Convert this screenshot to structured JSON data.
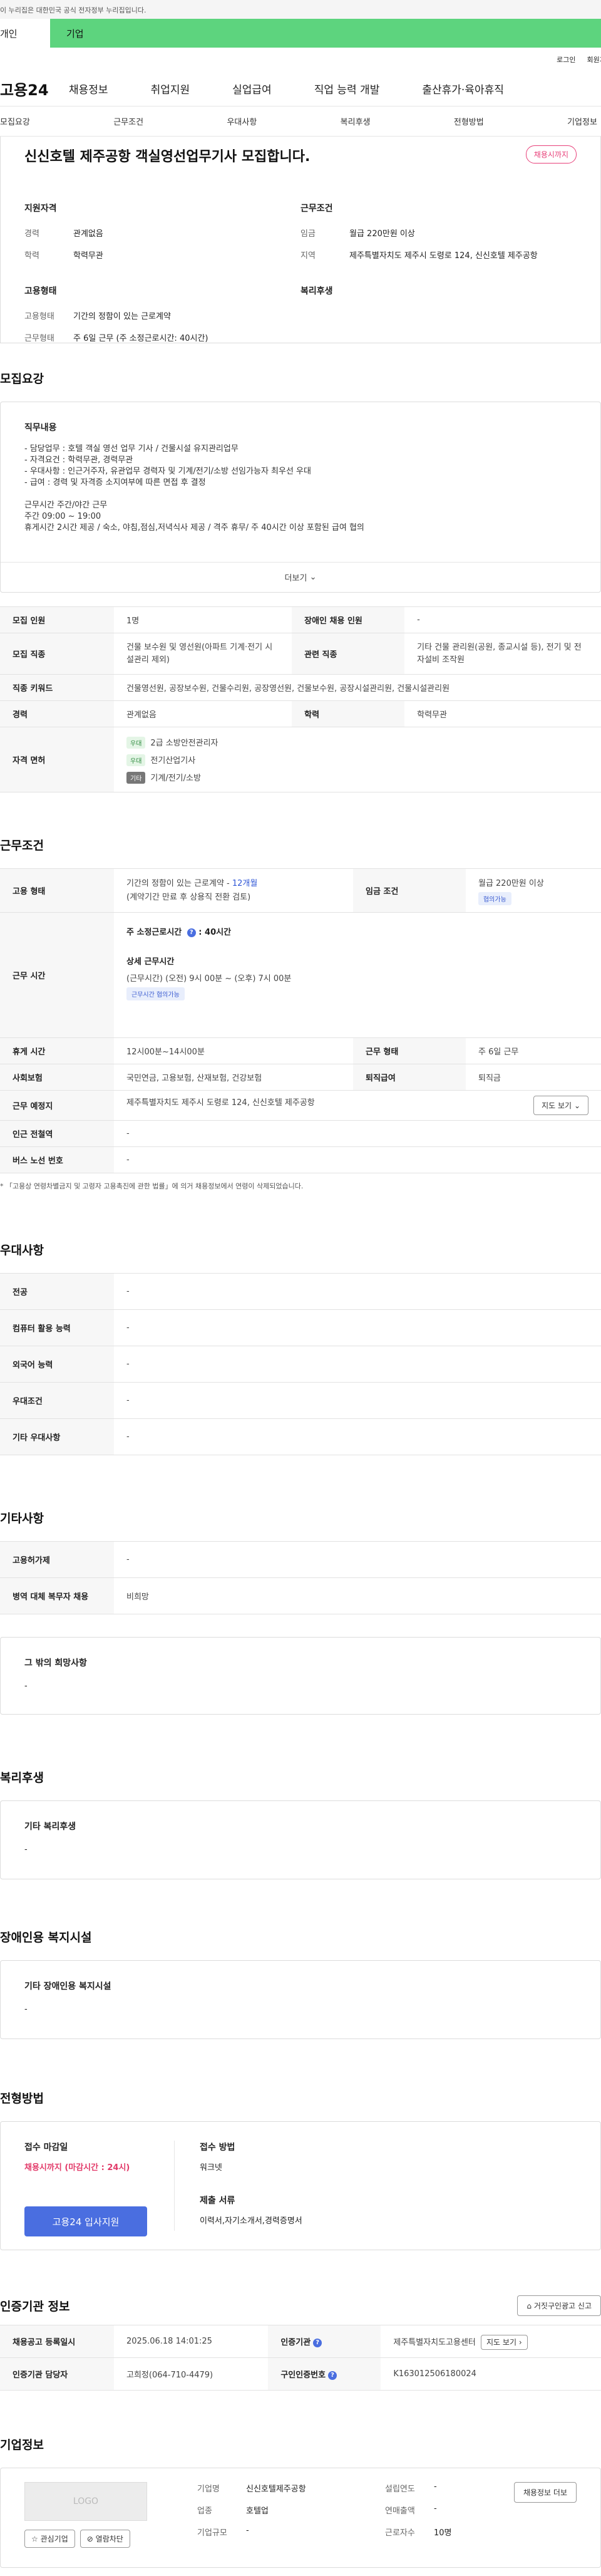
{
  "gov_banner": "이 누리집은 대한민국 공식 전자정부 누리집입니다.",
  "top_tabs": {
    "left": "개인",
    "right": "기업"
  },
  "util": {
    "login": "로그인",
    "join": "회원가입"
  },
  "logo": "고용24",
  "gnb": [
    "채용정보",
    "취업지원",
    "실업급여",
    "직업 능력 개발",
    "출산휴가·육아휴직"
  ],
  "subnav": [
    "모집요강",
    "근무조건",
    "우대사항",
    "복리후생",
    "전형방법",
    "기업정보"
  ],
  "job": {
    "title": "신신호텔 제주공항 객실영선업무기사 모집합니다.",
    "status": "채용시까지",
    "qual_title": "지원자격",
    "qual": [
      {
        "k": "경력",
        "v": "관계없음"
      },
      {
        "k": "학력",
        "v": "학력무관"
      }
    ],
    "cond_title": "근무조건",
    "cond": [
      {
        "k": "임금",
        "v": "월급 220만원 이상"
      },
      {
        "k": "지역",
        "v": "제주특별자치도 제주시 도령로 124, 신신호텔 제주공항"
      }
    ],
    "emp_title": "고용형태",
    "emp": [
      {
        "k": "고용형태",
        "v": "기간의 정함이 있는 근로계약"
      },
      {
        "k": "근무형태",
        "v": "주 6일 근무 (주 소정근로시간: 40시간)"
      }
    ],
    "welfare_title": "복리후생"
  },
  "recruit": {
    "title": "모집요강",
    "duty_title": "직무내용",
    "lines": [
      "- 담당업무 : 호텔 객실 영선 업무 기사 / 건물시설 유지관리업무",
      "- 자격요건 : 학력무관, 경력무관",
      "- 우대사항 : 인근거주자, 유관업무 경력자 및 기계/전기/소방 선임가능자 최우선 우대",
      "- 급여 : 경력 및 자격증 소지여부에 따른 면접 후 결정",
      "",
      "근무시간 주간/야간 근무",
      "주간 09:00 ~ 19:00",
      "휴게시간 2시간 제공 / 숙소, 야침,점심,저녁식사 제공 / 격주 휴무/ 주 40시간 이상 포함된 급여 협의"
    ],
    "more": "더보기",
    "rows": {
      "count_k": "모집 인원",
      "count_v": "1명",
      "disabled_k": "장애인 채용 인원",
      "disabled_v": "-",
      "job_k": "모집 직종",
      "job_v": "건물 보수원 및 영선원(아파트 기계·전기 시설관리 제외)",
      "rel_k": "관련 직종",
      "rel_v": "기타 건물 관리원(공원, 종교시설 등), 전기 및 전자설비 조작원",
      "kw_k": "직종 키워드",
      "kw_v": "건물영선원, 공장보수원, 건물수리원, 공장영선원, 건물보수원, 공장시설관리원, 건물시설관리원",
      "career_k": "경력",
      "career_v": "관계없음",
      "edu_k": "학력",
      "edu_v": "학력무관",
      "lic_k": "자격 면허",
      "lic": [
        {
          "tag": "우대",
          "name": "2급 소방안전관리자"
        },
        {
          "tag": "우대",
          "name": "전기산업기사"
        },
        {
          "tag": "기타",
          "name": "기계/전기/소방"
        }
      ]
    }
  },
  "work": {
    "title": "근무조건",
    "emp_k": "고용 형태",
    "emp_v1": "기간의 정함이 있는 근로계약 - ",
    "emp_v1b": "12개월",
    "emp_v2": "(계약기간 만료 후 상용직 전환 검토)",
    "wage_k": "임금 조건",
    "wage_v": "월급 220만원 이상",
    "wage_chip": "협의가능",
    "hours_k": "근무 시간",
    "hours_head": "주 소정근로시간",
    "hours_val": "40시간",
    "hours_detail_title": "상세 근무시간",
    "hours_detail": "(근무시간) (오전) 9시 00분 ~ (오후) 7시 00분",
    "hours_chip": "근무시간 협의가능",
    "break_k": "휴게 시간",
    "break_v": "12시00분~14시00분",
    "form_k": "근무 형태",
    "form_v": "주 6일 근무",
    "ins_k": "사회보험",
    "ins_v": "국민연금, 고용보험, 산재보험, 건강보험",
    "ret_k": "퇴직급여",
    "ret_v": "퇴직금",
    "place_k": "근무 예정지",
    "place_v": "제주특별자치도 제주시 도령로 124, 신신호텔 제주공항",
    "map": "지도 보기",
    "sub_k": "인근 전철역",
    "sub_v": "-",
    "bus_k": "버스 노선 번호",
    "bus_v": "-",
    "note": "* 「고용상 연령차별금지 및 고령자 고용촉진에 관한 법률」에 의거 채용정보에서 연령이 삭제되었습니다."
  },
  "pref": {
    "title": "우대사항",
    "rows": [
      {
        "k": "전공",
        "v": "-"
      },
      {
        "k": "컴퓨터 활용 능력",
        "v": "-"
      },
      {
        "k": "외국어 능력",
        "v": "-"
      },
      {
        "k": "우대조건",
        "v": "-"
      },
      {
        "k": "기타 우대사항",
        "v": "-"
      }
    ]
  },
  "etc": {
    "title": "기타사항",
    "rows": [
      {
        "k": "고용허가제",
        "v": "-"
      },
      {
        "k": "병역 대체 복무자 채용",
        "v": "비희망"
      }
    ],
    "box_title": "그 밖의 희망사항",
    "box_v": "-"
  },
  "welfare": {
    "title": "복리후생",
    "box_title": "기타 복리후생",
    "box_v": "-"
  },
  "disabled_fac": {
    "title": "장애인용 복지시설",
    "box_title": "기타 장애인용 복지시설",
    "box_v": "-"
  },
  "selection": {
    "title": "전형방법",
    "deadline_k": "접수 마감일",
    "deadline_v": "채용시까지 (마감시간 : 24시)",
    "apply_btn": "고용24 입사지원",
    "method_k": "접수 방법",
    "method_v": "워크넷",
    "docs_k": "제출 서류",
    "docs_v": "이력서,자기소개서,경력증명서"
  },
  "agency": {
    "title": "인증기관 정보",
    "report_btn": "거짓구인광고 신고",
    "reg_k": "채용공고 등록일시",
    "reg_v": "2025.06.18 14:01:25",
    "org_k": "인증기관",
    "org_v": "제주특별자치도고용센터",
    "map": "지도 보기",
    "mgr_k": "인증기관 담당자",
    "mgr_v": "고희정(064-710-4479)",
    "no_k": "구인인증번호",
    "no_v": "K163012506180024"
  },
  "company": {
    "title": "기업정보",
    "logo": "LOGO",
    "interest": "관심기업",
    "block": "열람차단",
    "name_k": "기업명",
    "name_v": "신신호텔제주공항",
    "ind_k": "업종",
    "ind_v": "호텔업",
    "size_k": "기업규모",
    "size_v": "-",
    "est_k": "설립연도",
    "est_v": "-",
    "sales_k": "연매출액",
    "sales_v": "-",
    "emp_k": "근로자수",
    "emp_v": "10명",
    "btn": "채용정보 더보"
  }
}
